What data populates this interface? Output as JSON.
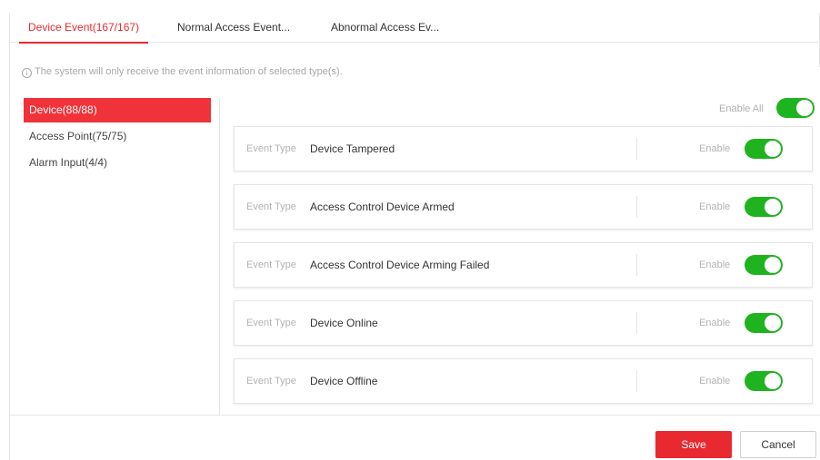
{
  "tabs": [
    {
      "label": "Device Event(167/167)",
      "active": true
    },
    {
      "label": "Normal Access Event...",
      "active": false
    },
    {
      "label": "Abnormal Access Ev...",
      "active": false
    }
  ],
  "hint": "The system will only receive the event information of selected type(s).",
  "sidebar": {
    "items": [
      {
        "label": "Device(88/88)",
        "active": true
      },
      {
        "label": "Access Point(75/75)",
        "active": false
      },
      {
        "label": "Alarm Input(4/4)",
        "active": false
      }
    ]
  },
  "enable_all": {
    "label": "Enable All",
    "enabled": true
  },
  "events": [
    {
      "type_label": "Event Type",
      "name": "Device Tampered",
      "enable_label": "Enable",
      "enabled": true
    },
    {
      "type_label": "Event Type",
      "name": "Access Control Device Armed",
      "enable_label": "Enable",
      "enabled": true
    },
    {
      "type_label": "Event Type",
      "name": "Access Control Device Arming Failed",
      "enable_label": "Enable",
      "enabled": true
    },
    {
      "type_label": "Event Type",
      "name": "Device Online",
      "enable_label": "Enable",
      "enabled": true
    },
    {
      "type_label": "Event Type",
      "name": "Device Offline",
      "enable_label": "Enable",
      "enabled": true
    }
  ],
  "footer": {
    "save_label": "Save",
    "cancel_label": "Cancel"
  },
  "colors": {
    "accent": "#e8292f",
    "toggle_on": "#1fb31f"
  }
}
